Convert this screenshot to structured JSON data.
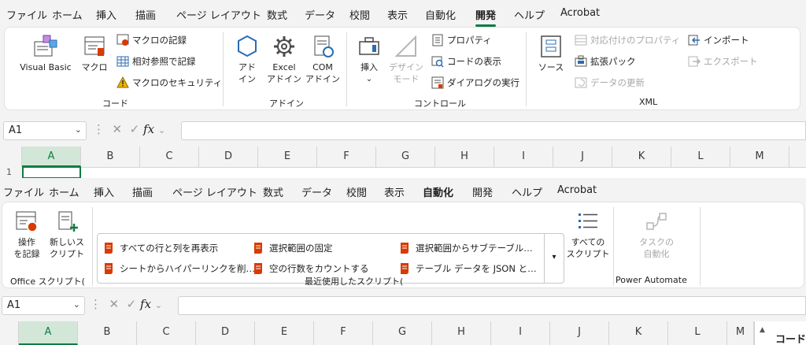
{
  "top": {
    "tabs": [
      "ファイル",
      "ホーム",
      "挿入",
      "描画",
      "ページ レイアウト",
      "数式",
      "データ",
      "校閲",
      "表示",
      "自動化",
      "開発",
      "ヘルプ",
      "Acrobat"
    ],
    "active_tab": "開発",
    "groups": {
      "code": {
        "label": "コード",
        "visual_basic": "Visual Basic",
        "macro": "マクロ",
        "record_macro": "マクロの記録",
        "relative_ref": "相対参照で記録",
        "macro_security": "マクロのセキュリティ"
      },
      "addins": {
        "label": "アドイン",
        "addin_l1": "アド",
        "addin_l2": "イン",
        "excel_l1": "Excel",
        "excel_l2": "アドイン",
        "com_l1": "COM",
        "com_l2": "アドイン"
      },
      "controls": {
        "label": "コントロール",
        "insert": "挿入",
        "design_l1": "デザイン",
        "design_l2": "モード",
        "properties": "プロパティ",
        "view_code": "コードの表示",
        "run_dialog": "ダイアログの実行"
      },
      "xml": {
        "label": "XML",
        "source": "ソース",
        "map_properties": "対応付けのプロパティ",
        "expansion_packs": "拡張パック",
        "refresh_data": "データの更新",
        "import": "インポート",
        "export": "エクスポート"
      }
    },
    "namebox": "A1",
    "fx": "fx",
    "columns": [
      "A",
      "B",
      "C",
      "D",
      "E",
      "F",
      "G",
      "H",
      "I",
      "J",
      "K",
      "L",
      "M"
    ],
    "row1": "1"
  },
  "bottom": {
    "tabs": [
      "ファイル",
      "ホーム",
      "挿入",
      "描画",
      "ページ レイアウト",
      "数式",
      "データ",
      "校閲",
      "表示",
      "自動化",
      "開発",
      "ヘルプ",
      "Acrobat"
    ],
    "active_tab": "自動化",
    "office_scripts": {
      "label": "Office スクリプト(",
      "record_l1": "操作",
      "record_l2": "を記録",
      "new_l1": "新しいス",
      "new_l2": "クリプト"
    },
    "recent_scripts": {
      "label": "最近使用したスクリプト(",
      "items": [
        "すべての行と列を再表示",
        "選択範囲の固定",
        "選択範囲からサブテーブル…",
        "シートからハイパーリンクを削…",
        "空の行数をカウントする",
        "テーブル データを JSON と…"
      ],
      "all_l1": "すべての",
      "all_l2": "スクリプト"
    },
    "power_automate": {
      "label": "Power Automate",
      "task_l1": "タスクの",
      "task_l2": "自動化"
    },
    "namebox": "A1",
    "fx": "fx",
    "columns": [
      "A",
      "B",
      "C",
      "D",
      "E",
      "F",
      "G",
      "H",
      "I",
      "J",
      "K",
      "L",
      "M"
    ],
    "side_panel_text": "コード"
  },
  "colors": {
    "accent": "#107c41",
    "script_icon": "#d83b01",
    "blue": "#2b6cb0"
  }
}
